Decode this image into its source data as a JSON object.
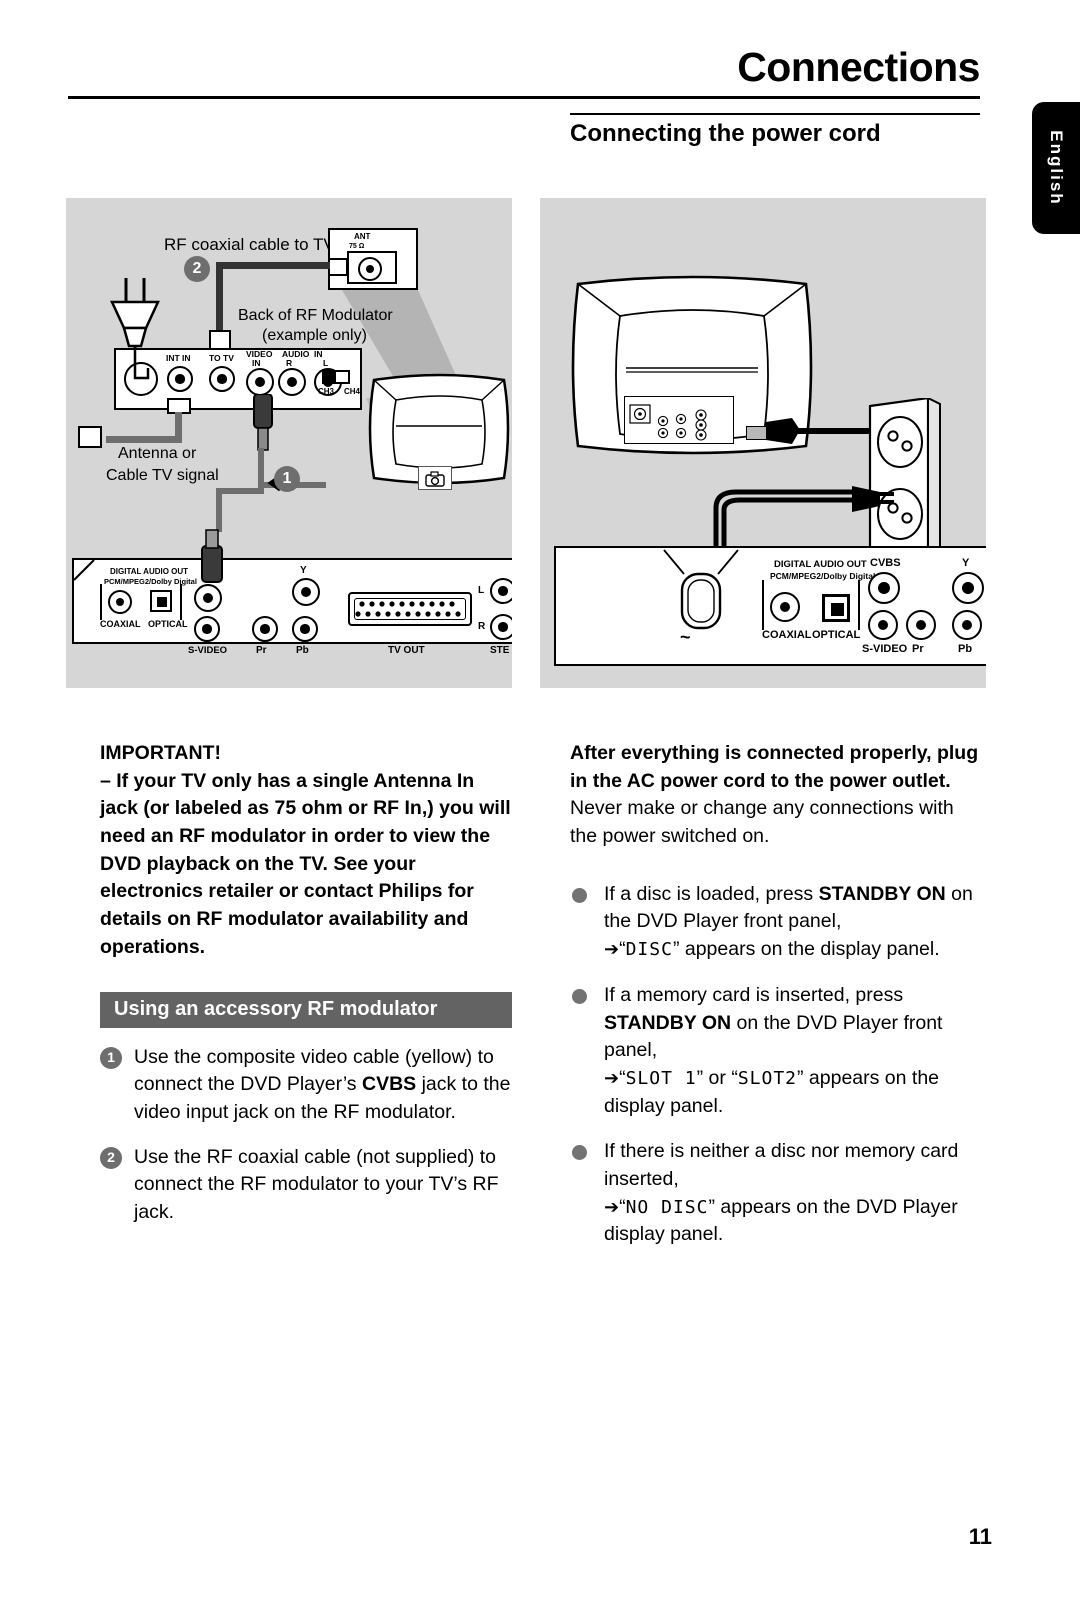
{
  "header": {
    "title": "Connections",
    "subhead": "Connecting the power cord",
    "lang_tab": "English"
  },
  "page_number": "11",
  "diagram_left": {
    "name": "rf-modulator-connection-diagram",
    "labels": {
      "rf_coax_to_tv": "RF coaxial cable to TV",
      "back_of_rf_modulator": "Back of RF Modulator",
      "example_only": "(example only)",
      "antenna_or": "Antenna or",
      "cable_tv_signal": "Cable TV signal",
      "ant_jack": "ANT",
      "ant_ohm": "75 Ω",
      "badge_1": "1",
      "badge_2": "2"
    },
    "modulator_ports": {
      "int_in": "INT IN",
      "to_tv": "TO TV",
      "video_in_1": "VIDEO",
      "video_in_2": "IN",
      "audio_in_1": "AUDIO",
      "audio_in_2": "IN",
      "audio_r": "R",
      "audio_l": "L",
      "ch3": "CH3",
      "ch4": "CH4"
    },
    "dvd_rear_ports": {
      "digital_audio_out": "DIGITAL AUDIO OUT",
      "pcm_mpeg": "PCM/MPEG2/Dolby Digital",
      "coaxial": "COAXIAL",
      "optical": "OPTICAL",
      "s_video": "S-VIDEO",
      "y": "Y",
      "pr": "Pr",
      "pb": "Pb",
      "tv_out": "TV OUT",
      "l": "L",
      "r": "R",
      "stereo": "STE"
    }
  },
  "diagram_right": {
    "name": "power-cord-connection-diagram",
    "dvd_rear_ports": {
      "digital_audio_out": "DIGITAL AUDIO OUT",
      "pcm_mpeg": "PCM/MPEG2/Dolby Digital",
      "coaxial": "COAXIAL",
      "optical": "OPTICAL",
      "s_video": "S-VIDEO",
      "cvbs": "CVBS",
      "y": "Y",
      "pr": "Pr",
      "pb": "Pb",
      "ac_mains": "~"
    }
  },
  "left_column": {
    "important_heading": "IMPORTANT!",
    "important_body": "–  If your TV only has a single Antenna In jack (or labeled as 75 ohm or RF In,)  you will need an RF modulator in order to view the DVD playback on the TV.  See your electronics retailer or contact Philips for details on RF modulator availability and operations.",
    "section_bar": "Using an accessory RF modulator",
    "steps": [
      {
        "number": "1",
        "part1": "Use the composite video cable (yellow) to connect the DVD Player’s ",
        "bold": "CVBS",
        "part2": " jack to the video input jack on the RF modulator."
      },
      {
        "number": "2",
        "part1": "Use the RF coaxial cable (not supplied) to connect the RF modulator to your TV’s RF jack.",
        "bold": "",
        "part2": ""
      }
    ]
  },
  "right_column": {
    "lead_bold": "After everything is connected properly, plug in the AC power cord to the power outlet.",
    "lead_norm": "Never make or change any connections with the power switched on.",
    "bullets": [
      {
        "pre": "If a disc is loaded, press ",
        "bold": "STANDBY ON",
        "post": " on the DVD Player front panel,",
        "arrow": "➔",
        "lcd_open": "“",
        "lcd": "DISC",
        "lcd_close": "”",
        "tail": " appears on the display panel."
      },
      {
        "pre": "If a memory card is inserted, press ",
        "bold": "STANDBY ON",
        "post": " on the DVD Player front panel,",
        "arrow": "➔",
        "lcd_open": "“",
        "lcd": "SLOT 1",
        "lcd_close": "”",
        "lcd_mid": " or ",
        "lcd2_open": "“",
        "lcd2": "SLOT2",
        "lcd2_close": "”",
        "tail": " appears on the display panel."
      },
      {
        "pre": "If there is neither a disc nor memory card inserted,",
        "bold": "",
        "post": "",
        "arrow": "➔",
        "lcd_open": "“",
        "lcd": "NO DISC",
        "lcd_close": "”",
        "tail": " appears on the DVD Player display panel."
      }
    ]
  }
}
